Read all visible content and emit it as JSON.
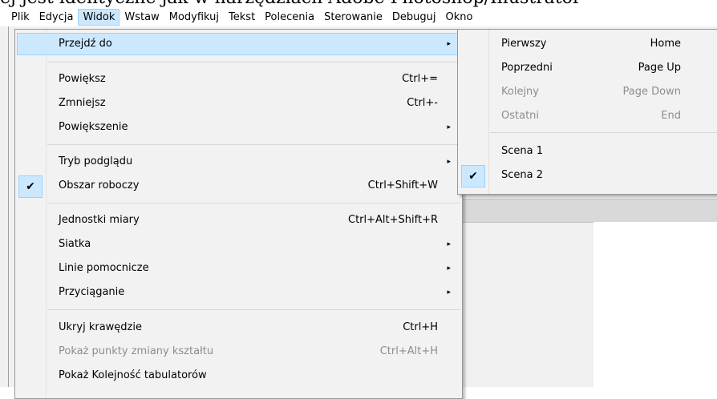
{
  "doc_text": "ej jest identyczne jak w narzędziach Adobe Photoshop/Illustrator",
  "menubar": {
    "items": [
      {
        "label": "Plik",
        "name": "menubar-plik"
      },
      {
        "label": "Edycja",
        "name": "menubar-edycja"
      },
      {
        "label": "Widok",
        "name": "menubar-widok"
      },
      {
        "label": "Wstaw",
        "name": "menubar-wstaw"
      },
      {
        "label": "Modyfikuj",
        "name": "menubar-modyfikuj"
      },
      {
        "label": "Tekst",
        "name": "menubar-tekst"
      },
      {
        "label": "Polecenia",
        "name": "menubar-polecenia"
      },
      {
        "label": "Sterowanie",
        "name": "menubar-sterowanie"
      },
      {
        "label": "Debuguj",
        "name": "menubar-debuguj"
      },
      {
        "label": "Okno",
        "name": "menubar-okno"
      }
    ]
  },
  "view_menu": {
    "items": [
      {
        "label": "Przejdź do",
        "shortcut": "",
        "submenu": true
      },
      {
        "label": "Powiększ",
        "shortcut": "Ctrl+=",
        "submenu": false
      },
      {
        "label": "Zmniejsz",
        "shortcut": "Ctrl+-",
        "submenu": false
      },
      {
        "label": "Powiększenie",
        "shortcut": "",
        "submenu": true
      },
      {
        "label": "Tryb podglądu",
        "shortcut": "",
        "submenu": true
      },
      {
        "label": "Obszar roboczy",
        "shortcut": "Ctrl+Shift+W",
        "submenu": false,
        "checked": true
      },
      {
        "label": "Jednostki miary",
        "shortcut": "Ctrl+Alt+Shift+R",
        "submenu": false
      },
      {
        "label": "Siatka",
        "shortcut": "",
        "submenu": true
      },
      {
        "label": "Linie pomocnicze",
        "shortcut": "",
        "submenu": true
      },
      {
        "label": "Przyciąganie",
        "shortcut": "",
        "submenu": true
      },
      {
        "label": "Ukryj krawędzie",
        "shortcut": "Ctrl+H",
        "submenu": false
      },
      {
        "label": "Pokaż punkty zmiany kształtu",
        "shortcut": "Ctrl+Alt+H",
        "submenu": false,
        "disabled": true
      },
      {
        "label": "Pokaż Kolejność tabulatorów",
        "shortcut": "",
        "submenu": false
      }
    ]
  },
  "goto_submenu": {
    "items": [
      {
        "label": "Pierwszy",
        "shortcut": "Home"
      },
      {
        "label": "Poprzedni",
        "shortcut": "Page Up"
      },
      {
        "label": "Kolejny",
        "shortcut": "Page Down",
        "disabled": true
      },
      {
        "label": "Ostatni",
        "shortcut": "End",
        "disabled": true
      },
      {
        "label": "Scena 1",
        "shortcut": ""
      },
      {
        "label": "Scena 2",
        "shortcut": "",
        "checked": true
      }
    ]
  },
  "icons": {
    "submenu_arrow": "▸",
    "check": "✔"
  },
  "colors": {
    "highlight": "#cce8ff",
    "highlight_border": "#99d1ff",
    "disabled_text": "#8d8d8d"
  }
}
